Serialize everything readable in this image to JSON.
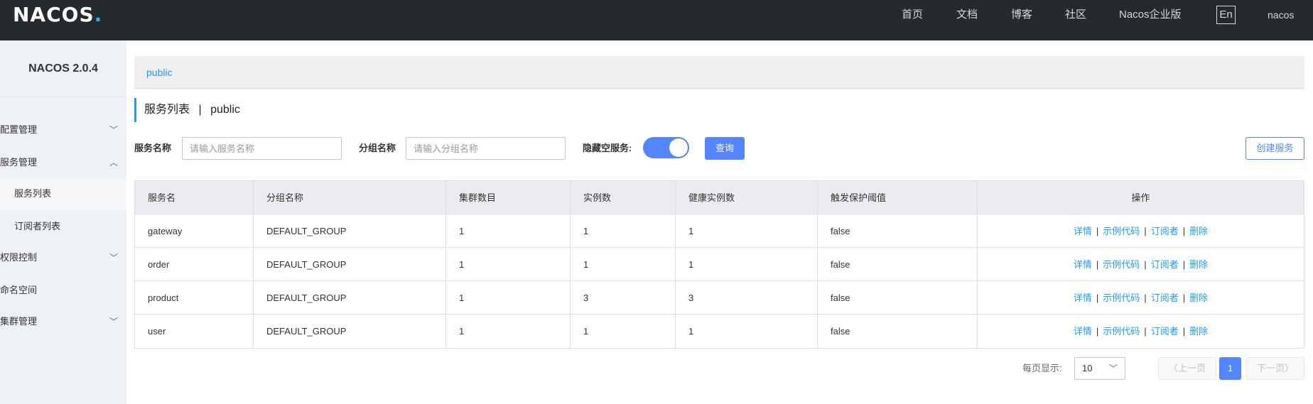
{
  "topbar": {
    "logo_main": "NACOS",
    "logo_dot": ".",
    "nav": [
      "首页",
      "文档",
      "博客",
      "社区",
      "Nacos企业版"
    ],
    "lang": "En",
    "user": "nacos"
  },
  "sidebar": {
    "brand": "NACOS 2.0.4",
    "items": [
      {
        "label": "配置管理"
      },
      {
        "label": "服务管理"
      },
      {
        "label": "服务列表"
      },
      {
        "label": "订阅者列表"
      },
      {
        "label": "权限控制"
      },
      {
        "label": "命名空间"
      },
      {
        "label": "集群管理"
      }
    ]
  },
  "breadcrumb": "public",
  "page": {
    "title": "服务列表",
    "separator": "|",
    "namespace": "public"
  },
  "filters": {
    "service_name_label": "服务名称",
    "service_name_placeholder": "请输入服务名称",
    "group_name_label": "分组名称",
    "group_name_placeholder": "请输入分组名称",
    "hide_empty_label": "隐藏空服务:",
    "hide_empty_on": true,
    "query_button": "查询",
    "create_button": "创建服务"
  },
  "table": {
    "columns": [
      "服务名",
      "分组名称",
      "集群数目",
      "实例数",
      "健康实例数",
      "触发保护阈值",
      "操作"
    ],
    "rows": [
      [
        "gateway",
        "DEFAULT_GROUP",
        "1",
        "1",
        "1",
        "false"
      ],
      [
        "order",
        "DEFAULT_GROUP",
        "1",
        "1",
        "1",
        "false"
      ],
      [
        "product",
        "DEFAULT_GROUP",
        "1",
        "3",
        "3",
        "false"
      ],
      [
        "user",
        "DEFAULT_GROUP",
        "1",
        "1",
        "1",
        "false"
      ]
    ],
    "actions": [
      "详情",
      "示例代码",
      "订阅者",
      "删除"
    ]
  },
  "pagination": {
    "page_size_label": "每页显示:",
    "page_size": "10",
    "prev": "上一页",
    "current": "1",
    "next": "下一页"
  },
  "colors": {
    "accent": "#5584ff",
    "link": "#209bfa",
    "topbar": "#252a2f",
    "sidebar": "#eef1f5"
  }
}
